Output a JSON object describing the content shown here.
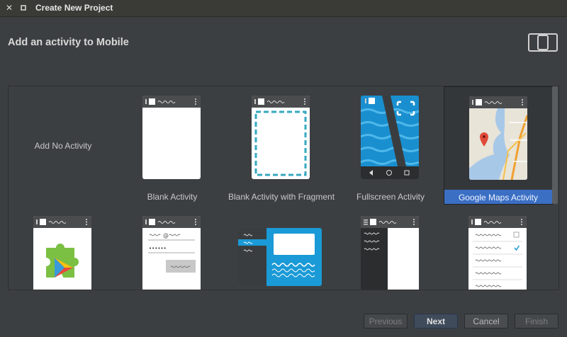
{
  "window": {
    "title": "Create New Project",
    "close_glyph": "✕",
    "restore_glyph": "▫"
  },
  "heading": "Add an activity to Mobile",
  "activities": [
    {
      "label": "Add No Activity"
    },
    {
      "label": "Blank Activity"
    },
    {
      "label": "Blank Activity with Fragment"
    },
    {
      "label": "Fullscreen Activity"
    },
    {
      "label": "Google Maps Activity",
      "selected": true
    }
  ],
  "buttons": {
    "previous": "Previous",
    "next": "Next",
    "cancel": "Cancel",
    "finish": "Finish"
  },
  "colors": {
    "selection": "#3b6fc4",
    "fullscreen_bg": "#1a8fd0",
    "fragment_border": "#35a8c0",
    "nav_blue": "#1a9ad6"
  }
}
